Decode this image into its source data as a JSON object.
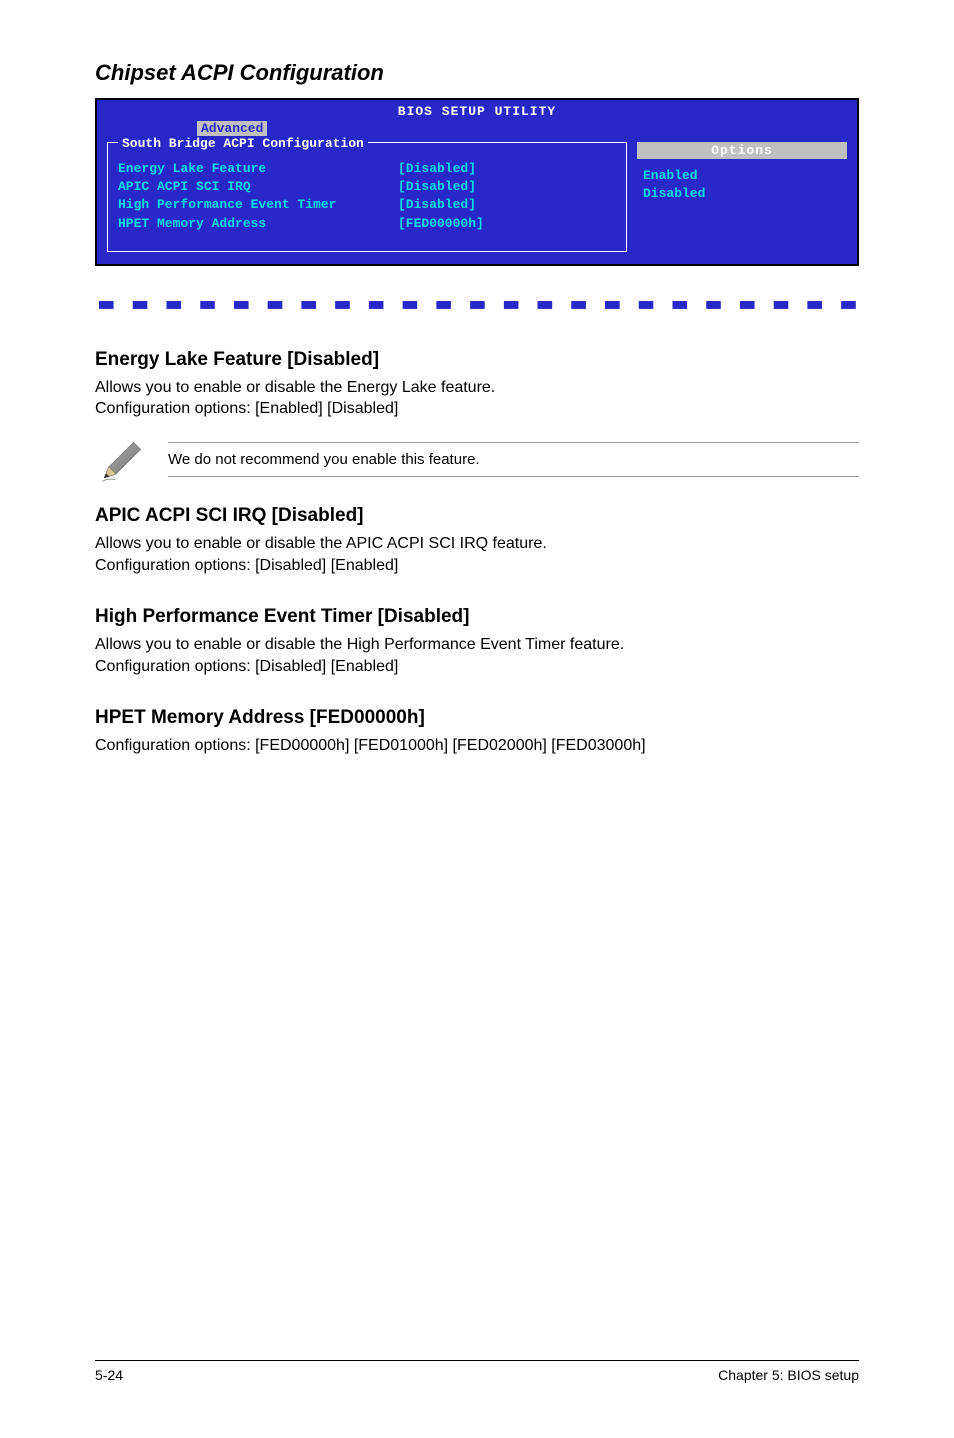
{
  "section_title": "Chipset ACPI Configuration",
  "bios": {
    "header": "BIOS SETUP UTILITY",
    "tab": "Advanced",
    "panel_title": "South Bridge ACPI Configuration",
    "rows": [
      {
        "label": "Energy Lake Feature",
        "value": "[Disabled]"
      },
      {
        "label": "APIC ACPI SCI IRQ",
        "value": "[Disabled]"
      },
      {
        "label": "High Performance Event Timer",
        "value": "[Disabled]"
      },
      {
        "label": "HPET Memory Address",
        "value": "[FED00000h]"
      }
    ],
    "options_title": "Options",
    "options": [
      "Enabled",
      "Disabled"
    ]
  },
  "sections": {
    "energy_lake": {
      "heading": "Energy Lake Feature [Disabled]",
      "line1": "Allows you to enable or disable the Energy Lake feature.",
      "line2": "Configuration options: [Enabled] [Disabled]"
    },
    "note": "We do not recommend you enable this feature.",
    "apic": {
      "heading": "APIC ACPI SCI IRQ [Disabled]",
      "line1": "Allows you to enable or disable the APIC ACPI SCI IRQ feature.",
      "line2": "Configuration options: [Disabled] [Enabled]"
    },
    "hpet_timer": {
      "heading": "High Performance Event Timer [Disabled]",
      "line1": "Allows you to enable or disable the High Performance Event Timer feature.",
      "line2": "Configuration options: [Disabled] [Enabled]"
    },
    "hpet_mem": {
      "heading": "HPET Memory Address [FED00000h]",
      "line1": "Configuration options: [FED00000h] [FED01000h] [FED02000h] [FED03000h]"
    }
  },
  "footer": {
    "page": "5-24",
    "chapter": "Chapter 5: BIOS setup"
  }
}
